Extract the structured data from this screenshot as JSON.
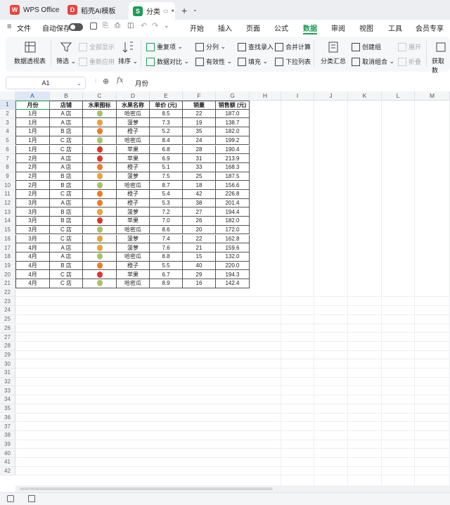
{
  "tabs": [
    {
      "label": "WPS Office",
      "icon": "wps-logo-icon",
      "color": "#e8453c"
    },
    {
      "label": "稻壳AI模板",
      "icon": "docer-logo-icon",
      "color": "#e8453c"
    },
    {
      "label": "分类",
      "icon": "sheet-logo-icon",
      "color": "#1e9c57"
    }
  ],
  "menubar": {
    "file": "文件",
    "autosave": "自动保存",
    "items": [
      "开始",
      "插入",
      "页面",
      "公式",
      "数据",
      "审阅",
      "视图",
      "工具",
      "会员专享"
    ],
    "active": "数据",
    "accent": "#1e9c57"
  },
  "ribbon": {
    "pivot": "数据透视表",
    "filter": "筛选",
    "show_all": "全部显示",
    "reapply": "重新应用",
    "sort": "排序",
    "duplicates": "重复项",
    "compare": "数据对比",
    "split": "分列",
    "validity": "有效性",
    "lookup": "查找录入",
    "fill": "填充",
    "merge_calc": "合并计算",
    "dropdown": "下拉列表",
    "subtotal": "分类汇总",
    "group": "创建组",
    "ungroup": "取消组合",
    "expand": "展开",
    "collapse": "折叠",
    "get_data": "获取数"
  },
  "formula": {
    "cell_ref": "A1",
    "content": "月份"
  },
  "columns": [
    "A",
    "B",
    "C",
    "D",
    "E",
    "F",
    "G",
    "H",
    "I",
    "J",
    "K",
    "L",
    "M"
  ],
  "headers": [
    "月份",
    "店铺",
    "水果图标",
    "水果名称",
    "单价 (元)",
    "销量",
    "销售额 (元)"
  ],
  "rows": [
    [
      "1月",
      "A 店",
      "pear",
      "哈密瓜",
      "8.5",
      "22",
      "187.0"
    ],
    [
      "1月",
      "A 店",
      "pineapple",
      "菠萝",
      "7.3",
      "19",
      "138.7"
    ],
    [
      "1月",
      "B 店",
      "orange",
      "橙子",
      "5.2",
      "35",
      "182.0"
    ],
    [
      "1月",
      "C 店",
      "pear",
      "哈密瓜",
      "8.4",
      "24",
      "199.2"
    ],
    [
      "1月",
      "C 店",
      "apple",
      "苹果",
      "6.8",
      "28",
      "190.4"
    ],
    [
      "2月",
      "A 店",
      "apple",
      "苹果",
      "6.9",
      "31",
      "213.9"
    ],
    [
      "2月",
      "A 店",
      "orange",
      "橙子",
      "5.1",
      "33",
      "168.3"
    ],
    [
      "2月",
      "B 店",
      "pineapple",
      "菠萝",
      "7.5",
      "25",
      "187.5"
    ],
    [
      "2月",
      "B 店",
      "pear",
      "哈密瓜",
      "8.7",
      "18",
      "156.6"
    ],
    [
      "2月",
      "C 店",
      "orange",
      "橙子",
      "5.4",
      "42",
      "226.8"
    ],
    [
      "3月",
      "A 店",
      "orange",
      "橙子",
      "5.3",
      "38",
      "201.4"
    ],
    [
      "3月",
      "B 店",
      "pineapple",
      "菠萝",
      "7.2",
      "27",
      "194.4"
    ],
    [
      "3月",
      "B 店",
      "apple",
      "苹果",
      "7.0",
      "26",
      "182.0"
    ],
    [
      "3月",
      "C 店",
      "pear",
      "哈密瓜",
      "8.6",
      "20",
      "172.0"
    ],
    [
      "3月",
      "C 店",
      "pineapple",
      "菠萝",
      "7.4",
      "22",
      "162.8"
    ],
    [
      "4月",
      "A 店",
      "pineapple",
      "菠萝",
      "7.6",
      "21",
      "159.6"
    ],
    [
      "4月",
      "A 店",
      "pear",
      "哈密瓜",
      "8.8",
      "15",
      "132.0"
    ],
    [
      "4月",
      "B 店",
      "orange",
      "橙子",
      "5.5",
      "40",
      "220.0"
    ],
    [
      "4月",
      "C 店",
      "apple",
      "苹果",
      "6.7",
      "29",
      "194.3"
    ],
    [
      "4月",
      "C 店",
      "pear",
      "哈密瓜",
      "8.9",
      "16",
      "142.4"
    ]
  ],
  "row_numbers": [
    "1",
    "2",
    "3",
    "4",
    "5",
    "6",
    "7",
    "8",
    "9",
    "10",
    "11",
    "12",
    "13",
    "14",
    "15",
    "16",
    "17",
    "18",
    "19",
    "20",
    "21",
    "22",
    "23",
    "24",
    "25",
    "26",
    "27",
    "28",
    "29",
    "30",
    "31",
    "32",
    "33",
    "34",
    "35",
    "36",
    "37",
    "38",
    "39",
    "40",
    "41",
    "42"
  ],
  "fruit_colors": {
    "pear": "#a8c46a",
    "pineapple": "#e8a33a",
    "orange": "#f07a24",
    "apple": "#e0352b"
  }
}
